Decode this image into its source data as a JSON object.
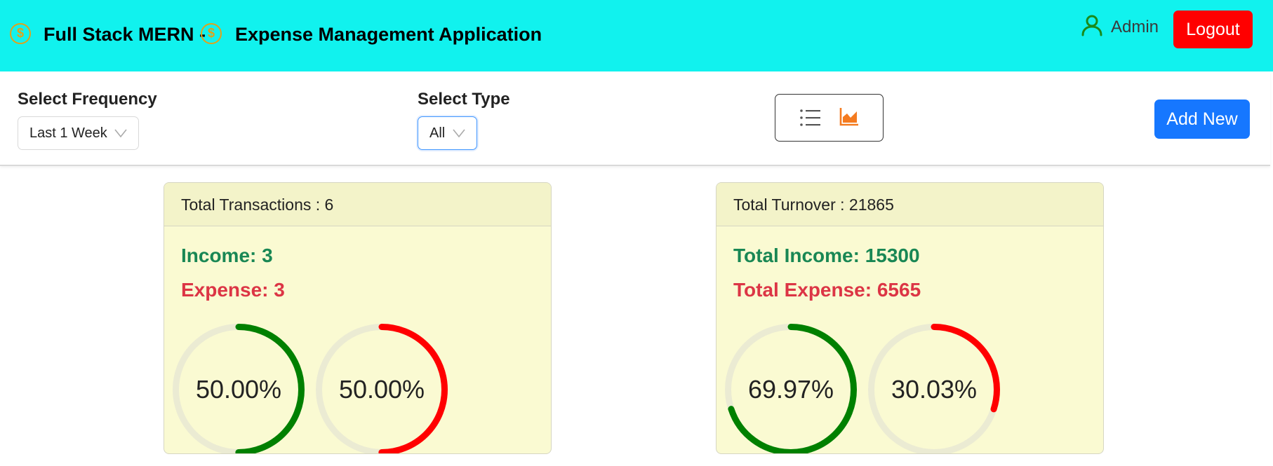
{
  "header": {
    "title_part1": "Full Stack MERN -",
    "title_part2": "Expense Management Application",
    "coin_icon": "dollar-coin-icon",
    "user_icon": "user-icon",
    "user_name": "Admin",
    "logout_label": "Logout",
    "background_color": "#11f2ee"
  },
  "filters": {
    "frequency_label": "Select Frequency",
    "frequency_value": "Last 1 Week",
    "type_label": "Select Type",
    "type_value": "All",
    "view_toggle": {
      "list_icon": "list-icon",
      "chart_icon": "area-chart-icon",
      "active": "chart"
    },
    "add_new_label": "Add New"
  },
  "transactions_card": {
    "header": "Total Transactions : 6",
    "income_text": "Income: 3",
    "expense_text": "Expense: 3",
    "income_percent_label": "50.00%",
    "expense_percent_label": "50.00%",
    "income_percent": 50.0,
    "expense_percent": 50.0
  },
  "turnover_card": {
    "header": "Total Turnover : 21865",
    "income_text": "Total Income: 15300",
    "expense_text": "Total Expense: 6565",
    "income_percent_label": "69.97%",
    "expense_percent_label": "30.03%",
    "income_percent": 69.97,
    "expense_percent": 30.03
  },
  "colors": {
    "income": "#008000",
    "expense": "#ff0000",
    "ring_track": "#ebebd3",
    "logout": "#ff0000",
    "primary": "#1677ff"
  }
}
